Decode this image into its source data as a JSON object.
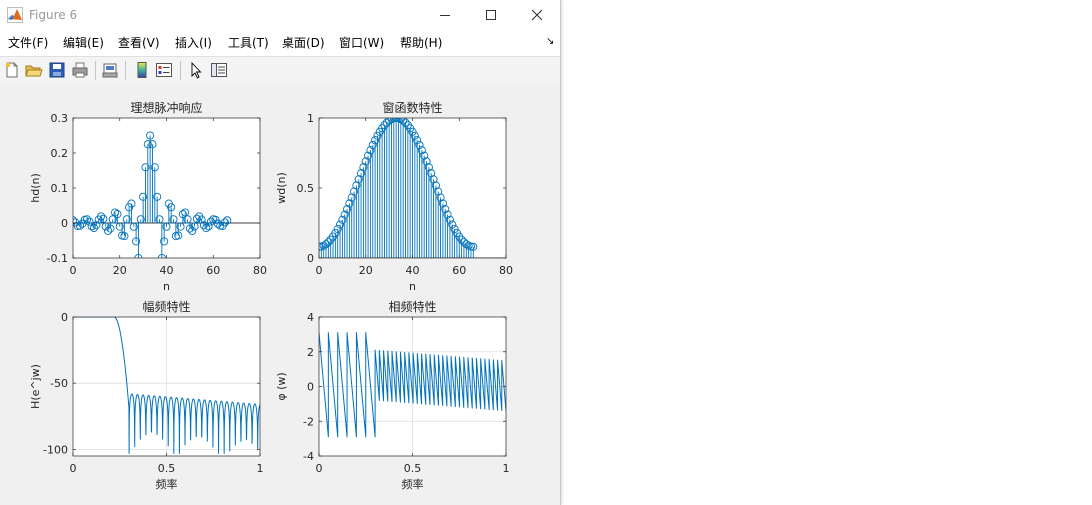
{
  "window": {
    "title": "Figure 6",
    "menu": [
      "文件(F)",
      "编辑(E)",
      "查看(V)",
      "插入(I)",
      "工具(T)",
      "桌面(D)",
      "窗口(W)",
      "帮助(H)"
    ],
    "toolbar_icons": [
      "new-figure-icon",
      "open-file-icon",
      "save-icon",
      "print-icon",
      "print-preview-icon",
      "colorbar-icon",
      "legend-icon",
      "edit-plot-arrow-icon",
      "property-inspector-icon"
    ]
  },
  "colors": {
    "series": "#0072bd",
    "window_bg": "#f0f0f0",
    "axes_bg": "#ffffff",
    "grid": "#dfdfdf"
  },
  "chart_data": [
    {
      "type": "stem",
      "title": "理想脉冲响应",
      "xlabel": "n",
      "ylabel": "hd(n)",
      "xlim": [
        0,
        80
      ],
      "ylim": [
        -0.1,
        0.3
      ],
      "xticks": [
        "0",
        "20",
        "40",
        "60",
        "80"
      ],
      "yticks": [
        "-0.1",
        "0",
        "0.1",
        "0.2",
        "0.3"
      ],
      "grid": false,
      "x_range": [
        0,
        66
      ],
      "values_note": "ideal lowpass impulse response, peak 0.25 at n=33",
      "values": [
        0.0076,
        0.0016,
        -0.0083,
        -0.0078,
        -0.0021,
        0.0091,
        0.0105,
        0.0039,
        -0.0095,
        -0.0142,
        -0.0062,
        0.0098,
        0.0189,
        0.012,
        -0.0101,
        -0.0226,
        -0.0159,
        0.0103,
        0.0299,
        0.0254,
        -0.0105,
        -0.0357,
        -0.0375,
        0.0106,
        0.045,
        0.0555,
        -0.0106,
        -0.0526,
        -0.1,
        0.0106,
        0.075,
        0.1592,
        0.2251,
        0.25,
        0.2251,
        0.1592,
        0.075,
        0.0106,
        -0.1,
        -0.0526,
        -0.0106,
        0.0555,
        0.045,
        0.0106,
        -0.0375,
        -0.0357,
        -0.0105,
        0.0254,
        0.0299,
        0.0103,
        -0.0159,
        -0.0226,
        -0.0101,
        0.012,
        0.0189,
        0.0098,
        -0.0062,
        -0.0142,
        -0.0095,
        0.0039,
        0.0105,
        0.0091,
        -0.0021,
        -0.0078,
        -0.0083,
        0.0016,
        0.0076
      ]
    },
    {
      "type": "stem",
      "title": "窗函数特性",
      "xlabel": "n",
      "ylabel": "wd(n)",
      "xlim": [
        0,
        80
      ],
      "ylim": [
        0,
        1
      ],
      "xticks": [
        "0",
        "20",
        "40",
        "60",
        "80"
      ],
      "yticks": [
        "0",
        "0.5",
        "1"
      ],
      "grid": false,
      "x_range": [
        0,
        66
      ],
      "values_note": "Hamming window of length 67",
      "window": "hamming",
      "N": 67
    },
    {
      "type": "line",
      "title": "幅频特性",
      "xlabel": "频率",
      "ylabel": "H(e^jw)",
      "xlim": [
        0,
        1
      ],
      "ylim": [
        -105,
        0
      ],
      "xticks": [
        "0",
        "0.5",
        "1"
      ],
      "yticks": [
        "-100",
        "-50",
        "0"
      ],
      "grid": true,
      "passband_edge": 0.22,
      "stopband_start": 0.3,
      "stopband_level": -58,
      "stopband_trend_end": -66,
      "null_depth": -103
    },
    {
      "type": "line",
      "title": "相频特性",
      "xlabel": "频率",
      "ylabel": "φ (w)",
      "xlim": [
        0,
        1
      ],
      "ylim": [
        -4,
        4
      ],
      "xticks": [
        "0",
        "0.5",
        "1"
      ],
      "yticks": [
        "-4",
        "-2",
        "0",
        "2",
        "4"
      ],
      "grid": true,
      "passband_cycles": 6,
      "passband_end": 0.3,
      "passband_range": [
        -2.9,
        3.1
      ],
      "stopband_cycles": 31,
      "stopband_start_range": [
        -0.8,
        2.1
      ],
      "stopband_end_range": [
        -1.4,
        1.5
      ]
    }
  ]
}
